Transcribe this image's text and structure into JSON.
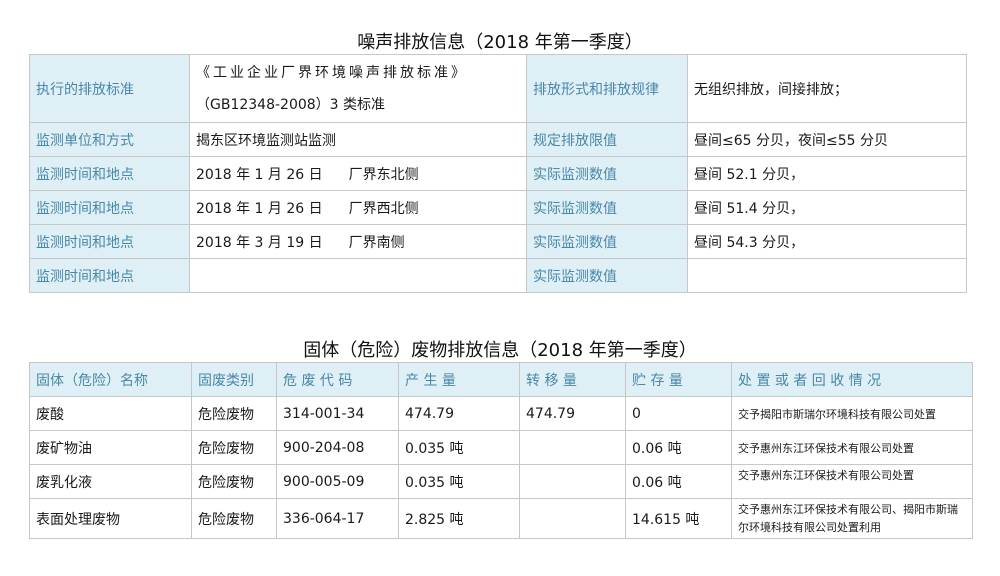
{
  "noise": {
    "title": "噪声排放信息（2018 年第一季度）",
    "standard_label": "执行的排放标准",
    "standard_line1": "《工业企业厂界环境噪声排放标准》",
    "standard_line2": "（GB12348-2008）3 类标准",
    "form_label": "排放形式和排放规律",
    "form_value": "无组织排放，间接排放；",
    "unit_label": "监测单位和方式",
    "unit_value": "揭东区环境监测站监测",
    "limit_label": "规定排放限值",
    "limit_value": "昼间≤65 分贝，夜间≤55 分贝",
    "rows": [
      {
        "label": "监测时间和地点",
        "date": "2018 年 1 月 26 日",
        "place": "厂界东北侧",
        "val_label": "实际监测数值",
        "value": "昼间 52.1 分贝，"
      },
      {
        "label": "监测时间和地点",
        "date": "2018 年 1 月 26 日",
        "place": "厂界西北侧",
        "val_label": "实际监测数值",
        "value": "昼间 51.4 分贝，"
      },
      {
        "label": "监测时间和地点",
        "date": "2018 年 3 月 19 日",
        "place": "厂界南侧",
        "val_label": "实际监测数值",
        "value": "昼间 54.3 分贝，"
      },
      {
        "label": "监测时间和地点",
        "date": "",
        "place": "",
        "val_label": "实际监测数值",
        "value": ""
      }
    ]
  },
  "waste": {
    "title": "固体（危险）废物排放信息（2018 年第一季度）",
    "headers": [
      "固体（危险）名称",
      "固废类别",
      "危 废 代 码",
      "产 生 量",
      "转 移 量",
      "贮 存 量",
      "处 置 或 者 回 收 情 况"
    ],
    "rows": [
      {
        "name": "废酸",
        "type": "危险废物",
        "code": "314-001-34",
        "produced": "474.79",
        "transferred": "474.79",
        "stored": "0",
        "disposal": "交予揭阳市斯瑞尔环境科技有限公司处置"
      },
      {
        "name": "废矿物油",
        "type": "危险废物",
        "code": "900-204-08",
        "produced": "0.035 吨",
        "transferred": "",
        "stored": "0.06 吨",
        "disposal": "交予惠州东江环保技术有限公司处置"
      },
      {
        "name": "废乳化液",
        "type": "危险废物",
        "code": "900-005-09",
        "produced": "0.035 吨",
        "transferred": "",
        "stored": "0.06 吨",
        "disposal": "交予惠州东江环保技术有限公司处置"
      },
      {
        "name": "表面处理废物",
        "type": "危险废物",
        "code": "336-064-17",
        "produced": "2.825 吨",
        "transferred": "",
        "stored": "14.615 吨",
        "disposal": "交予惠州东江环保技术有限公司、揭阳市斯瑞尔环境科技有限公司处置利用"
      }
    ]
  }
}
